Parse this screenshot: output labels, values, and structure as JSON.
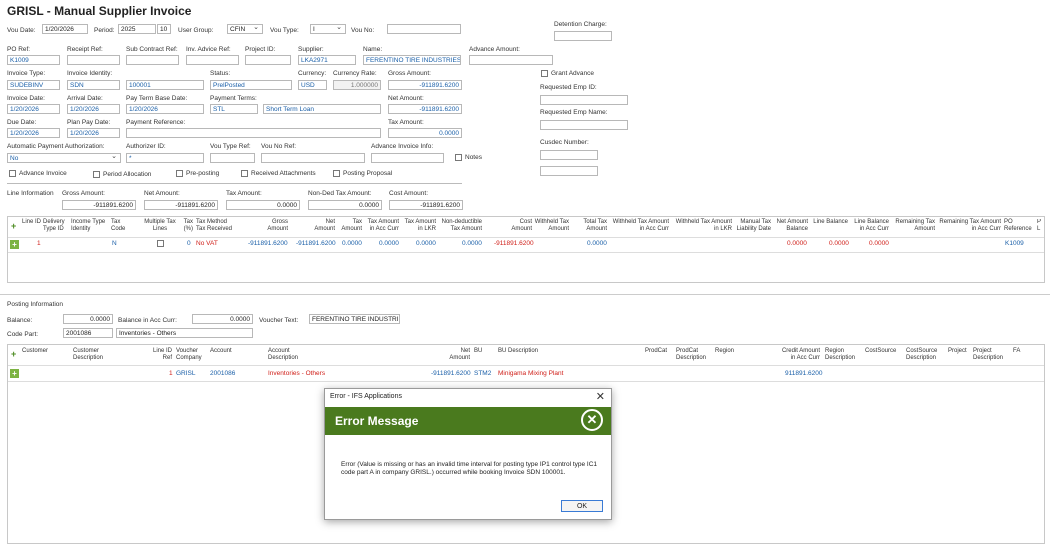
{
  "page": {
    "title": "GRISL - Manual Supplier Invoice"
  },
  "header": {
    "vou_date_label": "Vou Date:",
    "vou_date": "1/20/2026",
    "period_label": "Period:",
    "period_year": "2025",
    "period_num": "10",
    "user_group_label": "User Group:",
    "user_group": "CFIN",
    "vou_type_label": "Vou Type:",
    "vou_type": "I",
    "vou_no_label": "Vou No:",
    "vou_no": "",
    "detention_label": "Detention Charge:",
    "detention": "",
    "po_ref_label": "PO Ref:",
    "po_ref": "K1009",
    "receipt_ref_label": "Receipt Ref:",
    "receipt_ref": "",
    "sub_contract_label": "Sub Contract Ref:",
    "sub_contract": "",
    "inv_advice_label": "Inv. Advice Ref:",
    "inv_advice": "",
    "project_id_label": "Project ID:",
    "project_id": "",
    "supplier_label": "Supplier:",
    "supplier": "LKA2971",
    "name_label": "Name:",
    "name": "FERENTINO TIRE INDUSTRIES",
    "advance_amount_label": "Advance Amount:",
    "advance_amount": "",
    "invoice_type_label": "Invoice Type:",
    "invoice_type": "SUDEBINV",
    "invoice_identity_label": "Invoice Identity:",
    "invoice_identity_a": "SDN",
    "invoice_identity_b": "100001",
    "status_label": "Status:",
    "status": "PrelPosted",
    "currency_label": "Currency:",
    "currency": "USD",
    "currency_rate_label": "Currency Rate:",
    "currency_rate": "1.000000",
    "gross_amount_label": "Gross Amount:",
    "gross_amount": "-911891.6200",
    "grant_advance_label": "Grant Advance",
    "invoice_date_label": "Invoice Date:",
    "invoice_date": "1/20/2026",
    "arrival_date_label": "Arrival Date:",
    "arrival_date": "1/20/2026",
    "pay_term_base_label": "Pay Term Base Date:",
    "pay_term_base": "1/20/2026",
    "payment_terms_label": "Payment Terms:",
    "payment_terms_code": "STL",
    "payment_terms_desc": "Short Term Loan",
    "net_amount_label": "Net Amount:",
    "net_amount": "-911891.6200",
    "req_emp_id_label": "Requested Emp ID:",
    "req_emp_id": "",
    "due_date_label": "Due Date:",
    "due_date": "1/20/2026",
    "plan_pay_label": "Plan Pay Date:",
    "plan_pay": "1/20/2026",
    "payment_ref_label": "Payment Reference:",
    "payment_ref": "",
    "tax_amount_label": "Tax Amount:",
    "tax_amount": "0.0000",
    "req_emp_name_label": "Requested Emp Name:",
    "req_emp_name": "",
    "auto_pay_label": "Automatic Payment Authorization:",
    "auto_pay": "No",
    "authorizer_label": "Authorizer ID:",
    "authorizer": "*",
    "vou_type_ref_label": "Vou Type Ref:",
    "vou_type_ref": "",
    "vou_no_ref_label": "Vou No Ref:",
    "vou_no_ref": "",
    "adv_inv_info_label": "Advance Invoice Info:",
    "adv_inv_info": "",
    "notes_label": "Notes",
    "cusdec_label": "Cusdec Number:",
    "cusdec": "",
    "advance_invoice_label": "Advance Invoice",
    "period_alloc_label": "Period Allocation",
    "pre_posting_label": "Pre-posting",
    "received_att_label": "Received Attachments",
    "posting_proposal_label": "Posting Proposal"
  },
  "line_info": {
    "label": "Line Information",
    "gross_label": "Gross Amount:",
    "gross": "-911891.6200",
    "net_label": "Net Amount:",
    "net": "-911891.6200",
    "tax_label": "Tax Amount:",
    "tax": "0.0000",
    "nonded_label": "Non-Ded Tax Amount:",
    "nonded": "0.0000",
    "cost_label": "Cost Amount:",
    "cost": "-911891.6200"
  },
  "line_grid": {
    "headers": [
      "Line ID",
      "Delivery Type ID",
      "Income Type Identity",
      "Tax Code",
      "Multiple Tax Lines",
      "Tax (%)",
      "Tax Method Tax Received",
      "Gross Amount",
      "Net Amount",
      "Tax Amount",
      "Tax Amount in Acc Curr",
      "Tax Amount in LKR",
      "Non-deductible Tax Amount",
      "Cost Amount",
      "Withheld Tax Amount",
      "Total Tax Amount",
      "Withheld Tax Amount in Acc Curr",
      "Withheld Tax Amount in LKR",
      "Manual Tax Liability Date",
      "Net Amount Balance",
      "Line Balance",
      "Line Balance in Acc Curr",
      "Remaining Tax Amount",
      "Remaining Tax Amount in Acc Curr",
      "PO Reference",
      "P L"
    ],
    "row": {
      "line_id": "1",
      "tax_code": "N",
      "tax_pct": "0",
      "tax_method": "No VAT",
      "gross": "-911891.6200",
      "net": "-911891.6200",
      "tax": "0.0000",
      "tax_acc": "0.0000",
      "tax_lkr": "0.0000",
      "nonded": "0.0000",
      "cost": "-911891.6200",
      "total_tax": "0.0000",
      "net_bal": "0.0000",
      "line_bal": "0.0000",
      "line_bal_acc": "0.0000",
      "po_ref": "K1009"
    }
  },
  "posting": {
    "label": "Posting Information",
    "balance_label": "Balance:",
    "balance": "0.0000",
    "balance_acc_label": "Balance in Acc Curr:",
    "balance_acc": "0.0000",
    "voucher_text_label": "Voucher Text:",
    "voucher_text": "FERENTINO TIRE INDUSTRIES",
    "code_part_label": "Code Part:",
    "code_part": "2001086",
    "code_part_desc": "Inventories - Others"
  },
  "posting_grid": {
    "headers": [
      "Customer",
      "Customer Description",
      "Line ID Ref",
      "Voucher Company",
      "Account",
      "Account Description",
      "Net Amount",
      "BU",
      "BU Description",
      "ProdCat",
      "ProdCat Description",
      "Region",
      "Credit Amount in Acc Curr",
      "Region Description",
      "CostSource",
      "CostSource Description",
      "Project",
      "Project Description",
      "FA"
    ],
    "row": {
      "line_ref": "1",
      "company": "GRISL",
      "account": "2001086",
      "account_desc": "Inventories - Others",
      "net": "-911891.6200",
      "bu": "STM2",
      "bu_desc": "Minigama Mixing Plant",
      "credit_acc": "911891.6200"
    }
  },
  "dialog": {
    "title": "Error - IFS Applications",
    "heading": "Error Message",
    "message": "Error (Value is missing or has an invalid time interval for posting type IP1 control type IC1 code part A in company GRISL.) occurred while booking Invoice SDN 100001.",
    "ok": "OK"
  }
}
